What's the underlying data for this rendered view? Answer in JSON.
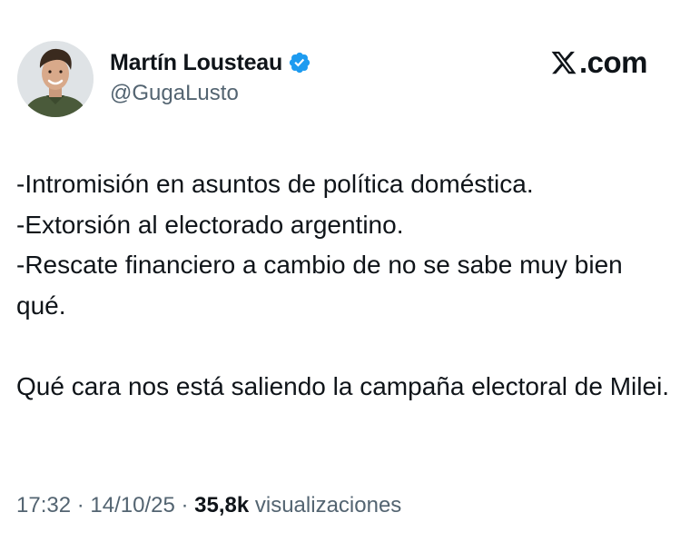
{
  "author": {
    "display_name": "Martín Lousteau",
    "handle": "@GugaLusto",
    "verified": true,
    "verified_icon": "verified-badge-icon",
    "avatar_icon": "profile-photo"
  },
  "brand": {
    "logo_text": ".com",
    "logo_icon": "x-logo-icon"
  },
  "tweet": {
    "lines": [
      "-Intromisión en asuntos de política doméstica.",
      "-Extorsión al electorado argentino.",
      "-Rescate financiero a cambio de no se sabe muy bien qué."
    ],
    "closing": "Qué cara nos está saliendo la campaña electoral de Milei."
  },
  "meta": {
    "time": "17:32",
    "separator": " · ",
    "date": "14/10/25",
    "views_count": "35,8k",
    "views_label": "visualizaciones"
  },
  "colors": {
    "text_primary": "#0f1419",
    "text_secondary": "#536471",
    "verified_blue": "#1d9bf0"
  }
}
